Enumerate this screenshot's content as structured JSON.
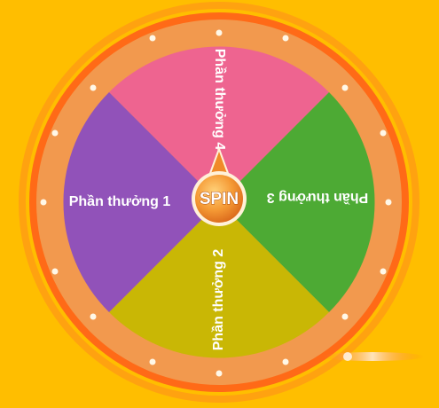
{
  "wheel": {
    "spin_label": "SPIN",
    "prizes": [
      {
        "label": "Phần thưởng 1",
        "color": "#9152B9"
      },
      {
        "label": "Phần thưởng 2",
        "color": "#C9B705"
      },
      {
        "label": "Phần thưởng 3",
        "color": "#4DAA34"
      },
      {
        "label": "Phần thưởng 4",
        "color": "#EE6490"
      }
    ]
  },
  "colors": {
    "background": "#FFBE00",
    "rim_outer": "#FF6A17",
    "rim_inner": "#F2994E",
    "bulb": "#FFF8E8",
    "hub": "#F08A28"
  }
}
